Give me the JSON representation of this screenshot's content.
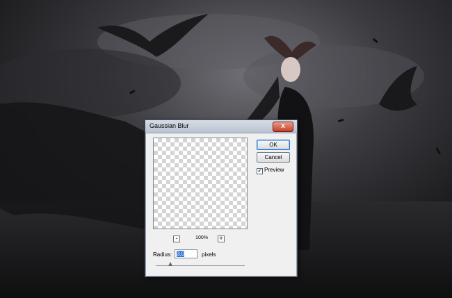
{
  "dialog": {
    "title": "Gaussian Blur",
    "close_glyph": "x",
    "ok_label": "OK",
    "cancel_label": "Cancel",
    "preview_label": "Preview",
    "preview_checked": true,
    "zoom_minus": "-",
    "zoom_plus": "+",
    "zoom_level": "100%",
    "radius_label": "Radius:",
    "radius_value": "3.0",
    "radius_unit": "pixels"
  },
  "colors": {
    "background": "#1f1f21",
    "dialog_face": "#f0f0f0",
    "titlebar": "#c9cfd8",
    "close_button": "#c3412b",
    "selection": "#3a77d6"
  }
}
